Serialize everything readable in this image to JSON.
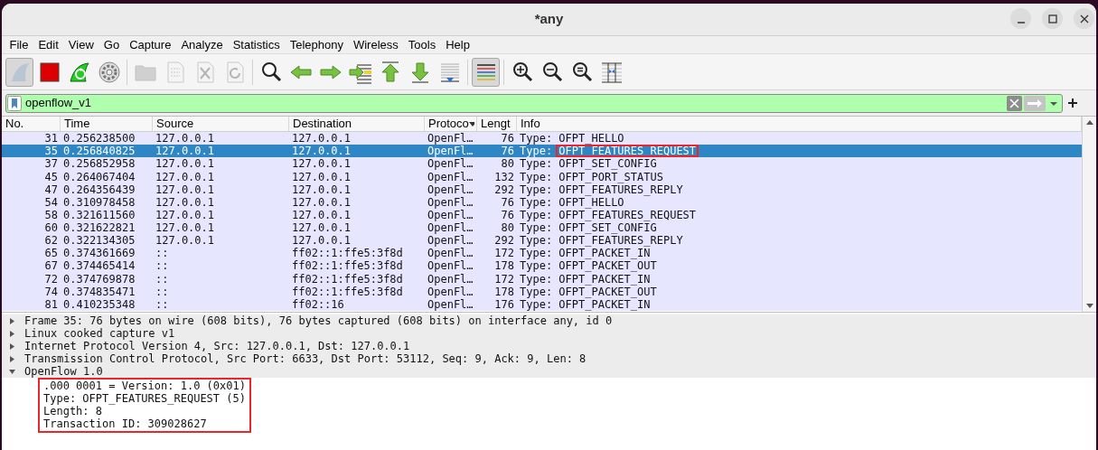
{
  "window": {
    "title": "*any"
  },
  "menu": [
    "File",
    "Edit",
    "View",
    "Go",
    "Capture",
    "Analyze",
    "Statistics",
    "Telephony",
    "Wireless",
    "Tools",
    "Help"
  ],
  "toolbar": [
    [
      {
        "kind": "start",
        "pressed": true,
        "disabled": true
      },
      {
        "kind": "stop",
        "pressed": false,
        "disabled": false
      },
      {
        "kind": "restart",
        "pressed": false,
        "disabled": false
      },
      {
        "kind": "options",
        "pressed": false,
        "disabled": false
      }
    ],
    [
      {
        "kind": "open",
        "pressed": false,
        "disabled": true
      },
      {
        "kind": "save",
        "pressed": false,
        "disabled": true
      },
      {
        "kind": "close",
        "pressed": false,
        "disabled": true
      },
      {
        "kind": "reload",
        "pressed": false,
        "disabled": true
      }
    ],
    [
      {
        "kind": "find",
        "pressed": false,
        "disabled": false
      },
      {
        "kind": "back",
        "pressed": false,
        "disabled": false
      },
      {
        "kind": "forward",
        "pressed": false,
        "disabled": false
      },
      {
        "kind": "goto",
        "pressed": false,
        "disabled": false
      },
      {
        "kind": "first",
        "pressed": false,
        "disabled": false
      },
      {
        "kind": "last",
        "pressed": false,
        "disabled": false
      },
      {
        "kind": "autoscroll",
        "pressed": false,
        "disabled": false
      }
    ],
    [
      {
        "kind": "colorize",
        "pressed": true,
        "disabled": false
      }
    ],
    [
      {
        "kind": "zoom_in",
        "pressed": false,
        "disabled": false
      },
      {
        "kind": "zoom_out",
        "pressed": false,
        "disabled": false
      },
      {
        "kind": "zoom_reset",
        "pressed": false,
        "disabled": false
      },
      {
        "kind": "resize",
        "pressed": false,
        "disabled": false
      }
    ]
  ],
  "filter": {
    "value": "openflow_v1"
  },
  "packet_list": {
    "columns": [
      "No.",
      "Time",
      "Source",
      "Destination",
      "Protoco",
      "Lengt",
      "Info"
    ],
    "rows": [
      {
        "no": "31",
        "time": "0.256238500",
        "source": "127.0.0.1",
        "destination": "127.0.0.1",
        "protocol": "OpenFl…",
        "length": "76",
        "info": "Type: OFPT_HELLO",
        "selected": false,
        "highlighted": false
      },
      {
        "no": "35",
        "time": "0.256840825",
        "source": "127.0.0.1",
        "destination": "127.0.0.1",
        "protocol": "OpenFl…",
        "length": "76",
        "info": "Type: OFPT_FEATURES_REQUEST",
        "selected": true,
        "highlighted": true
      },
      {
        "no": "37",
        "time": "0.256852958",
        "source": "127.0.0.1",
        "destination": "127.0.0.1",
        "protocol": "OpenFl…",
        "length": "80",
        "info": "Type: OFPT_SET_CONFIG",
        "selected": false,
        "highlighted": false
      },
      {
        "no": "45",
        "time": "0.264067404",
        "source": "127.0.0.1",
        "destination": "127.0.0.1",
        "protocol": "OpenFl…",
        "length": "132",
        "info": "Type: OFPT_PORT_STATUS",
        "selected": false,
        "highlighted": false
      },
      {
        "no": "47",
        "time": "0.264356439",
        "source": "127.0.0.1",
        "destination": "127.0.0.1",
        "protocol": "OpenFl…",
        "length": "292",
        "info": "Type: OFPT_FEATURES_REPLY",
        "selected": false,
        "highlighted": false
      },
      {
        "no": "54",
        "time": "0.310978458",
        "source": "127.0.0.1",
        "destination": "127.0.0.1",
        "protocol": "OpenFl…",
        "length": "76",
        "info": "Type: OFPT_HELLO",
        "selected": false,
        "highlighted": false
      },
      {
        "no": "58",
        "time": "0.321611560",
        "source": "127.0.0.1",
        "destination": "127.0.0.1",
        "protocol": "OpenFl…",
        "length": "76",
        "info": "Type: OFPT_FEATURES_REQUEST",
        "selected": false,
        "highlighted": false
      },
      {
        "no": "60",
        "time": "0.321622821",
        "source": "127.0.0.1",
        "destination": "127.0.0.1",
        "protocol": "OpenFl…",
        "length": "80",
        "info": "Type: OFPT_SET_CONFIG",
        "selected": false,
        "highlighted": false
      },
      {
        "no": "62",
        "time": "0.322134305",
        "source": "127.0.0.1",
        "destination": "127.0.0.1",
        "protocol": "OpenFl…",
        "length": "292",
        "info": "Type: OFPT_FEATURES_REPLY",
        "selected": false,
        "highlighted": false
      },
      {
        "no": "65",
        "time": "0.374361669",
        "source": "::",
        "destination": "ff02::1:ffe5:3f8d",
        "protocol": "OpenFl…",
        "length": "172",
        "info": "Type: OFPT_PACKET_IN",
        "selected": false,
        "highlighted": false
      },
      {
        "no": "67",
        "time": "0.374465414",
        "source": "::",
        "destination": "ff02::1:ffe5:3f8d",
        "protocol": "OpenFl…",
        "length": "178",
        "info": "Type: OFPT_PACKET_OUT",
        "selected": false,
        "highlighted": false
      },
      {
        "no": "72",
        "time": "0.374769878",
        "source": "::",
        "destination": "ff02::1:ffe5:3f8d",
        "protocol": "OpenFl…",
        "length": "172",
        "info": "Type: OFPT_PACKET_IN",
        "selected": false,
        "highlighted": false
      },
      {
        "no": "74",
        "time": "0.374835471",
        "source": "::",
        "destination": "ff02::1:ffe5:3f8d",
        "protocol": "OpenFl…",
        "length": "178",
        "info": "Type: OFPT_PACKET_OUT",
        "selected": false,
        "highlighted": false
      },
      {
        "no": "81",
        "time": "0.410235348",
        "source": "::",
        "destination": "ff02::16",
        "protocol": "OpenFl…",
        "length": "176",
        "info": "Type: OFPT_PACKET_IN",
        "selected": false,
        "highlighted": false
      }
    ]
  },
  "details": [
    {
      "text": "Frame 35: 76 bytes on wire (608 bits), 76 bytes captured (608 bits) on interface any, id 0",
      "expanded": false
    },
    {
      "text": "Linux cooked capture v1",
      "expanded": false
    },
    {
      "text": "Internet Protocol Version 4, Src: 127.0.0.1, Dst: 127.0.0.1",
      "expanded": false
    },
    {
      "text": "Transmission Control Protocol, Src Port: 6633, Dst Port: 53112, Seq: 9, Ack: 9, Len: 8",
      "expanded": false
    },
    {
      "text": "OpenFlow 1.0",
      "expanded": true,
      "children_highlighted": true,
      "children": [
        {
          "text": ".000 0001 = Version: 1.0 (0x01)"
        },
        {
          "text": "Type: OFPT_FEATURES_REQUEST (5)"
        },
        {
          "text": "Length: 8"
        },
        {
          "text": "Transaction ID: 309028627"
        }
      ]
    }
  ]
}
